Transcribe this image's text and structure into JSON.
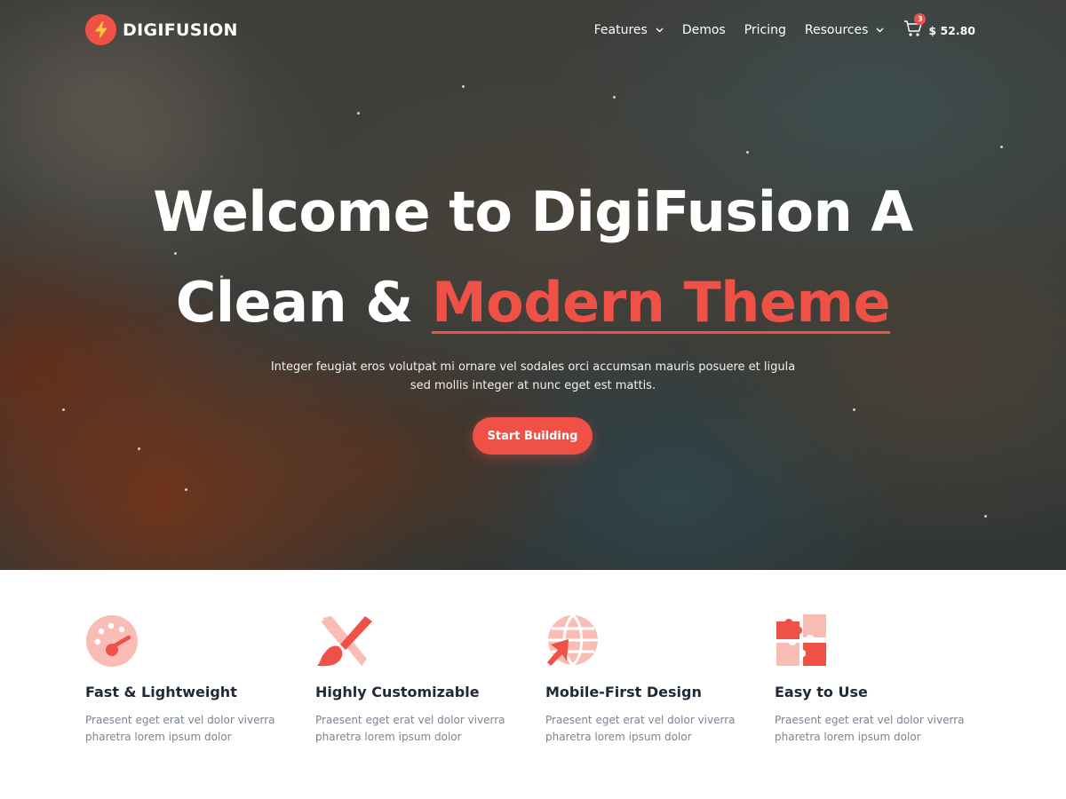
{
  "brand": {
    "name": "DIGIFUSION",
    "accent_color": "#ef5147",
    "logo_icon": "bolt-icon"
  },
  "nav": {
    "items": [
      {
        "label": "Features",
        "has_dropdown": true
      },
      {
        "label": "Demos",
        "has_dropdown": false
      },
      {
        "label": "Pricing",
        "has_dropdown": false
      },
      {
        "label": "Resources",
        "has_dropdown": true
      }
    ],
    "cart": {
      "icon": "cart-icon",
      "count": "3",
      "total": "$ 52.80"
    }
  },
  "hero": {
    "line1": "Welcome to DigiFusion A",
    "line2_prefix": "Clean & ",
    "line2_accent": "Modern Theme",
    "subtitle": "Integer feugiat eros volutpat mi ornare vel sodales orci accumsan mauris posuere et ligula sed mollis integer at nunc eget est mattis.",
    "cta_label": "Start Building"
  },
  "features": [
    {
      "icon": "speedometer-icon",
      "title": "Fast & Lightweight",
      "description": "Praesent eget erat vel dolor viverra pharetra lorem ipsum dolor"
    },
    {
      "icon": "paintbrush-icon",
      "title": "Highly Customizable",
      "description": "Praesent eget erat vel dolor viverra pharetra lorem ipsum dolor"
    },
    {
      "icon": "globe-pointer-icon",
      "title": "Mobile-First Design",
      "description": "Praesent eget erat vel dolor viverra pharetra lorem ipsum dolor"
    },
    {
      "icon": "puzzle-icon",
      "title": "Easy to Use",
      "description": "Praesent eget erat vel dolor viverra pharetra lorem ipsum dolor"
    }
  ]
}
